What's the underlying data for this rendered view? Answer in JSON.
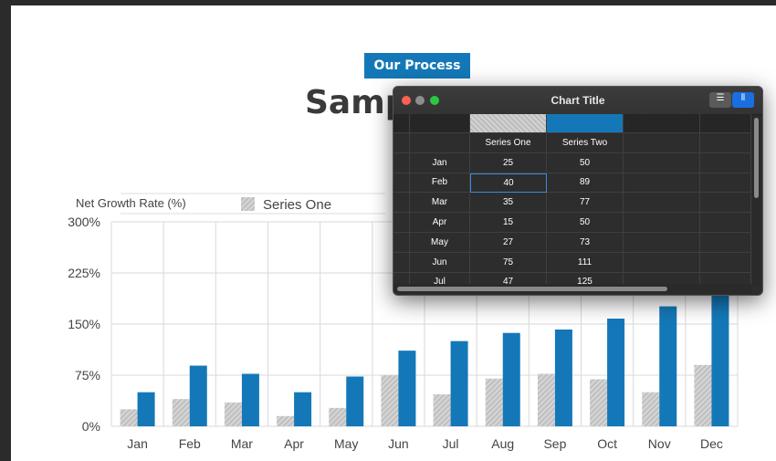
{
  "slide": {
    "badge": "Our Process",
    "title": "Sampl"
  },
  "chart_data": {
    "type": "bar",
    "ylabel": "Net Growth Rate (%)",
    "categories": [
      "Jan",
      "Feb",
      "Mar",
      "Apr",
      "May",
      "Jun",
      "Jul",
      "Aug",
      "Sep",
      "Oct",
      "Nov",
      "Dec"
    ],
    "series": [
      {
        "name": "Series One",
        "values": [
          25,
          40,
          35,
          15,
          27,
          75,
          47,
          70,
          77,
          69,
          50,
          90
        ],
        "color": "#cfcfcf"
      },
      {
        "name": "Series Two",
        "values": [
          50,
          89,
          77,
          50,
          73,
          111,
          125,
          137,
          142,
          158,
          176,
          200
        ],
        "color": "#1478b8"
      }
    ],
    "ylim": [
      0,
      300
    ],
    "yticks": [
      0,
      75,
      150,
      225,
      300
    ],
    "ytick_labels": [
      "0%",
      "75%",
      "150%",
      "225%",
      "300%"
    ],
    "grid": true,
    "legend": "top"
  },
  "window": {
    "title": "Chart Title",
    "view_list_icon": "list-icon",
    "view_columns_icon": "columns-icon",
    "headers": [
      "Series One",
      "Series Two"
    ],
    "rows": [
      {
        "label": "Jan",
        "one": "25",
        "two": "50"
      },
      {
        "label": "Feb",
        "one": "40",
        "two": "89"
      },
      {
        "label": "Mar",
        "one": "35",
        "two": "77"
      },
      {
        "label": "Apr",
        "one": "15",
        "two": "50"
      },
      {
        "label": "May",
        "one": "27",
        "two": "73"
      },
      {
        "label": "Jun",
        "one": "75",
        "two": "111"
      },
      {
        "label": "Jul",
        "one": "47",
        "two": "125"
      }
    ]
  }
}
